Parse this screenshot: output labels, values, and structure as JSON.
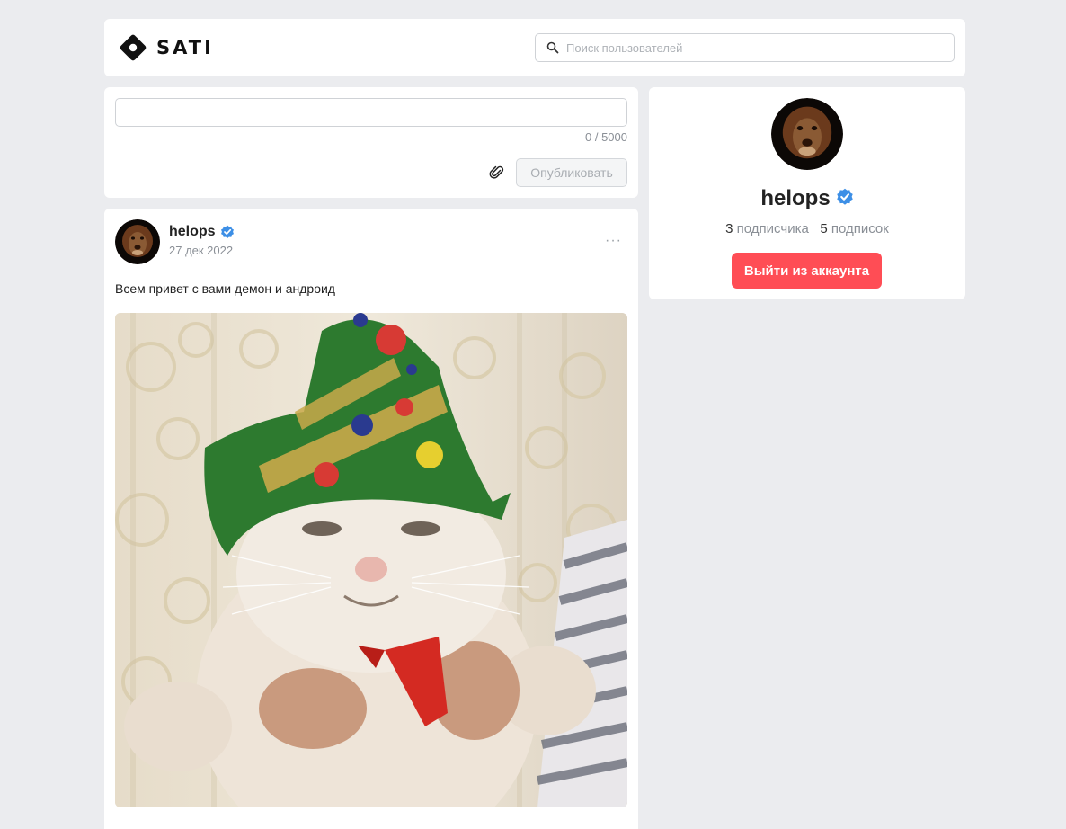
{
  "app": {
    "logo_text": "SATI"
  },
  "search": {
    "placeholder": "Поиск пользователей",
    "value": ""
  },
  "composer": {
    "value": "",
    "counter": "0 / 5000",
    "publish_label": "Опубликовать"
  },
  "post": {
    "author": "helops",
    "date": "27 дек 2022",
    "more_label": "···",
    "text": "Всем привет с вами демон и андроид"
  },
  "profile": {
    "name": "helops",
    "followers_count": "3",
    "followers_label": "подписчика",
    "following_count": "5",
    "following_label": "подписок",
    "logout_label": "Выйти из аккаунта"
  },
  "colors": {
    "accent_red": "#ff4d55",
    "verified_blue": "#3d8fe6",
    "background": "#ebecef"
  }
}
